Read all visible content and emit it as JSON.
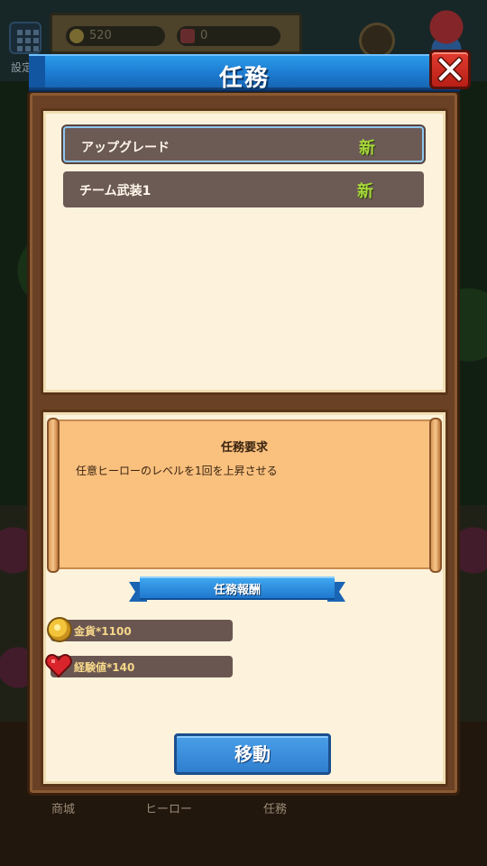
{
  "background": {
    "hud": {
      "coins": "520",
      "gems": "0"
    },
    "settings_label": "設定",
    "bottom_nav": [
      "商城",
      "ヒーロー",
      "任務"
    ]
  },
  "dialog": {
    "title": "任務",
    "close_icon": "close-x-icon",
    "quests": [
      {
        "label": "アップグレード",
        "badge": "新",
        "selected": true
      },
      {
        "label": "チーム武装1",
        "badge": "新",
        "selected": false
      }
    ],
    "requirement": {
      "title": "任務要求",
      "description": "任意ヒーローのレベルを1回を上昇させる"
    },
    "reward_header": "任務報酬",
    "rewards": [
      {
        "icon": "coin-icon",
        "text": "金貨*1100"
      },
      {
        "icon": "heart-icon",
        "text": "経験値*140"
      }
    ],
    "move_button": "移動"
  },
  "colors": {
    "accent_blue": "#1c79cf",
    "close_red": "#d42f24",
    "panel_brown": "#6a4125",
    "parchment": "#fdf3dc",
    "new_badge_green": "#a6d63a"
  }
}
